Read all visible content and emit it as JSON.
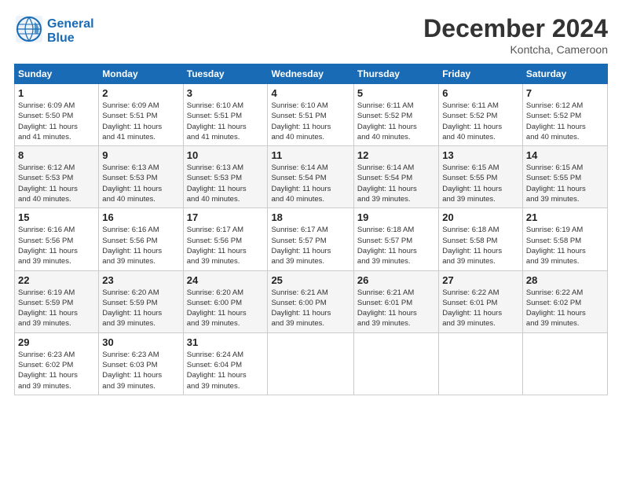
{
  "logo": {
    "line1": "General",
    "line2": "Blue"
  },
  "header": {
    "month": "December 2024",
    "location": "Kontcha, Cameroon"
  },
  "weekdays": [
    "Sunday",
    "Monday",
    "Tuesday",
    "Wednesday",
    "Thursday",
    "Friday",
    "Saturday"
  ],
  "weeks": [
    [
      {
        "day": "1",
        "info": "Sunrise: 6:09 AM\nSunset: 5:50 PM\nDaylight: 11 hours\nand 41 minutes."
      },
      {
        "day": "2",
        "info": "Sunrise: 6:09 AM\nSunset: 5:51 PM\nDaylight: 11 hours\nand 41 minutes."
      },
      {
        "day": "3",
        "info": "Sunrise: 6:10 AM\nSunset: 5:51 PM\nDaylight: 11 hours\nand 41 minutes."
      },
      {
        "day": "4",
        "info": "Sunrise: 6:10 AM\nSunset: 5:51 PM\nDaylight: 11 hours\nand 40 minutes."
      },
      {
        "day": "5",
        "info": "Sunrise: 6:11 AM\nSunset: 5:52 PM\nDaylight: 11 hours\nand 40 minutes."
      },
      {
        "day": "6",
        "info": "Sunrise: 6:11 AM\nSunset: 5:52 PM\nDaylight: 11 hours\nand 40 minutes."
      },
      {
        "day": "7",
        "info": "Sunrise: 6:12 AM\nSunset: 5:52 PM\nDaylight: 11 hours\nand 40 minutes."
      }
    ],
    [
      {
        "day": "8",
        "info": "Sunrise: 6:12 AM\nSunset: 5:53 PM\nDaylight: 11 hours\nand 40 minutes."
      },
      {
        "day": "9",
        "info": "Sunrise: 6:13 AM\nSunset: 5:53 PM\nDaylight: 11 hours\nand 40 minutes."
      },
      {
        "day": "10",
        "info": "Sunrise: 6:13 AM\nSunset: 5:53 PM\nDaylight: 11 hours\nand 40 minutes."
      },
      {
        "day": "11",
        "info": "Sunrise: 6:14 AM\nSunset: 5:54 PM\nDaylight: 11 hours\nand 40 minutes."
      },
      {
        "day": "12",
        "info": "Sunrise: 6:14 AM\nSunset: 5:54 PM\nDaylight: 11 hours\nand 39 minutes."
      },
      {
        "day": "13",
        "info": "Sunrise: 6:15 AM\nSunset: 5:55 PM\nDaylight: 11 hours\nand 39 minutes."
      },
      {
        "day": "14",
        "info": "Sunrise: 6:15 AM\nSunset: 5:55 PM\nDaylight: 11 hours\nand 39 minutes."
      }
    ],
    [
      {
        "day": "15",
        "info": "Sunrise: 6:16 AM\nSunset: 5:56 PM\nDaylight: 11 hours\nand 39 minutes."
      },
      {
        "day": "16",
        "info": "Sunrise: 6:16 AM\nSunset: 5:56 PM\nDaylight: 11 hours\nand 39 minutes."
      },
      {
        "day": "17",
        "info": "Sunrise: 6:17 AM\nSunset: 5:56 PM\nDaylight: 11 hours\nand 39 minutes."
      },
      {
        "day": "18",
        "info": "Sunrise: 6:17 AM\nSunset: 5:57 PM\nDaylight: 11 hours\nand 39 minutes."
      },
      {
        "day": "19",
        "info": "Sunrise: 6:18 AM\nSunset: 5:57 PM\nDaylight: 11 hours\nand 39 minutes."
      },
      {
        "day": "20",
        "info": "Sunrise: 6:18 AM\nSunset: 5:58 PM\nDaylight: 11 hours\nand 39 minutes."
      },
      {
        "day": "21",
        "info": "Sunrise: 6:19 AM\nSunset: 5:58 PM\nDaylight: 11 hours\nand 39 minutes."
      }
    ],
    [
      {
        "day": "22",
        "info": "Sunrise: 6:19 AM\nSunset: 5:59 PM\nDaylight: 11 hours\nand 39 minutes."
      },
      {
        "day": "23",
        "info": "Sunrise: 6:20 AM\nSunset: 5:59 PM\nDaylight: 11 hours\nand 39 minutes."
      },
      {
        "day": "24",
        "info": "Sunrise: 6:20 AM\nSunset: 6:00 PM\nDaylight: 11 hours\nand 39 minutes."
      },
      {
        "day": "25",
        "info": "Sunrise: 6:21 AM\nSunset: 6:00 PM\nDaylight: 11 hours\nand 39 minutes."
      },
      {
        "day": "26",
        "info": "Sunrise: 6:21 AM\nSunset: 6:01 PM\nDaylight: 11 hours\nand 39 minutes."
      },
      {
        "day": "27",
        "info": "Sunrise: 6:22 AM\nSunset: 6:01 PM\nDaylight: 11 hours\nand 39 minutes."
      },
      {
        "day": "28",
        "info": "Sunrise: 6:22 AM\nSunset: 6:02 PM\nDaylight: 11 hours\nand 39 minutes."
      }
    ],
    [
      {
        "day": "29",
        "info": "Sunrise: 6:23 AM\nSunset: 6:02 PM\nDaylight: 11 hours\nand 39 minutes."
      },
      {
        "day": "30",
        "info": "Sunrise: 6:23 AM\nSunset: 6:03 PM\nDaylight: 11 hours\nand 39 minutes."
      },
      {
        "day": "31",
        "info": "Sunrise: 6:24 AM\nSunset: 6:04 PM\nDaylight: 11 hours\nand 39 minutes."
      },
      {
        "day": "",
        "info": ""
      },
      {
        "day": "",
        "info": ""
      },
      {
        "day": "",
        "info": ""
      },
      {
        "day": "",
        "info": ""
      }
    ]
  ]
}
